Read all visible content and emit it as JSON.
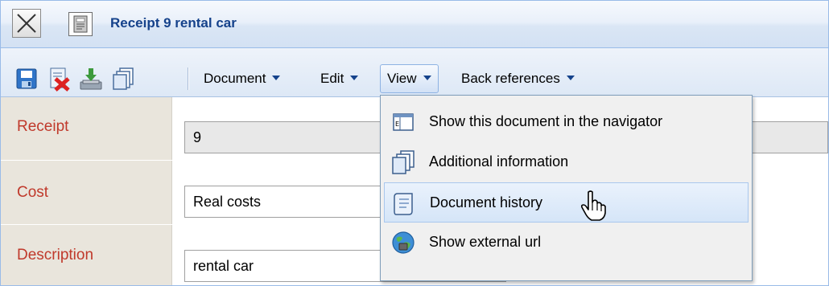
{
  "window": {
    "title": "Receipt 9 rental car"
  },
  "toolbar": {
    "icons": [
      "save-icon",
      "delete-icon",
      "export-icon",
      "copy-icon"
    ],
    "menus": [
      {
        "label": "Document"
      },
      {
        "label": "Edit"
      },
      {
        "label": "View",
        "active": true
      },
      {
        "label": "Back references"
      }
    ]
  },
  "form": {
    "fields": [
      {
        "label": "Receipt",
        "value": "9",
        "readonly": true
      },
      {
        "label": "Cost",
        "value": "Real costs"
      },
      {
        "label": "Description",
        "value": "rental car"
      }
    ]
  },
  "view_menu": {
    "items": [
      {
        "label": "Show this document in the navigator",
        "icon": "navigator-icon"
      },
      {
        "label": "Additional information",
        "icon": "info-pages-icon"
      },
      {
        "label": "Document history",
        "icon": "history-icon",
        "hover": true
      },
      {
        "label": "Show external url",
        "icon": "globe-icon"
      }
    ]
  },
  "colors": {
    "title": "#15428b",
    "label": "#c0392b",
    "toolbar_bg": "#dde8f6"
  }
}
